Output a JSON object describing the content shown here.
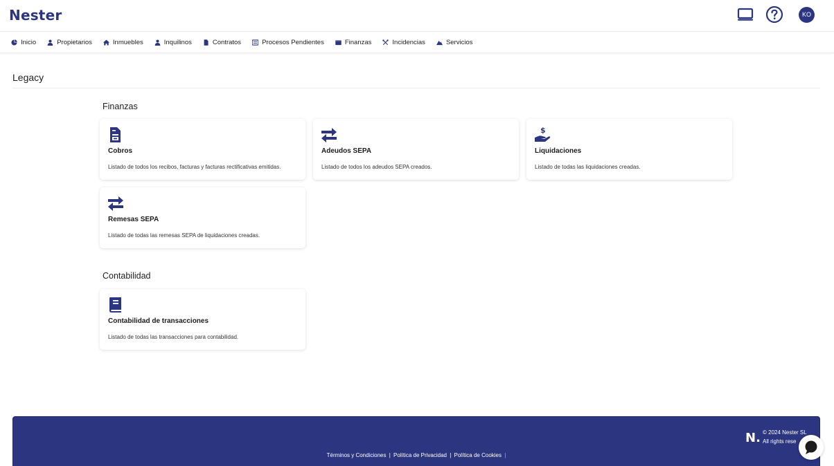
{
  "header": {
    "logo": "Nester",
    "avatar_initials": "KO",
    "icons": [
      "monitor-icon",
      "help-icon"
    ]
  },
  "nav": {
    "items": [
      {
        "label": "Inicio",
        "icon": "chart-pie-icon"
      },
      {
        "label": "Propietarios",
        "icon": "user-icon"
      },
      {
        "label": "Inmuebles",
        "icon": "home-icon"
      },
      {
        "label": "Inquilinos",
        "icon": "user-icon"
      },
      {
        "label": "Contratos",
        "icon": "file-icon"
      },
      {
        "label": "Procesos Pendientes",
        "icon": "list-icon"
      },
      {
        "label": "Finanzas",
        "icon": "wallet-icon"
      },
      {
        "label": "Incidencias",
        "icon": "tools-icon"
      },
      {
        "label": "Servicios",
        "icon": "mountain-icon"
      }
    ]
  },
  "page": {
    "title": "Legacy"
  },
  "sections": [
    {
      "title": "Finanzas",
      "cards": [
        {
          "title": "Cobros",
          "description": "Listado de todos los recibos, facturas y facturas rectificativas emitidas.",
          "icon": "invoice-icon"
        },
        {
          "title": "Adeudos SEPA",
          "description": "Listado de todos los adeudos SEPA creados.",
          "icon": "transfer-icon"
        },
        {
          "title": "Liquidaciones",
          "description": "Listado de todas las liquidaciones creadas.",
          "icon": "hand-dollar-icon"
        },
        {
          "title": "Remesas SEPA",
          "description": "Listado de todas las remesas SEPA de liquidaciones creadas.",
          "icon": "transfer-icon"
        }
      ]
    },
    {
      "title": "Contabilidad",
      "cards": [
        {
          "title": "Contabilidad de transacciones",
          "description": "Listado de todas las transacciones para contabilidad.",
          "icon": "book-icon"
        }
      ]
    }
  ],
  "footer": {
    "logo": "N.",
    "copyright_line1": "© 2024 Nester SL",
    "copyright_line2": "All rights rese",
    "links": [
      "Términos y Condiciones",
      "Política de Privacidad",
      "Política de Cookies"
    ],
    "separator": "|"
  },
  "colors": {
    "brand": "#2b3580",
    "background": "#ffffff"
  }
}
